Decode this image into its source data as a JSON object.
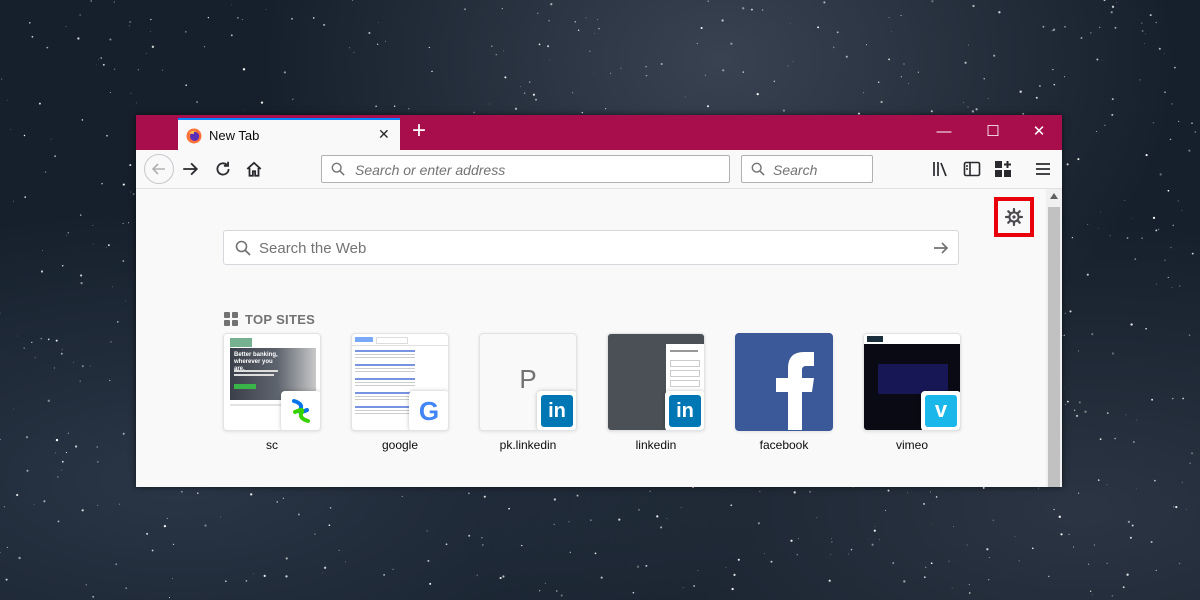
{
  "browser": {
    "tab": {
      "title": "New Tab",
      "close_glyph": "✕",
      "icon": "firefox-icon"
    },
    "new_tab_glyph": "+",
    "window_controls": {
      "minimize": "—",
      "maximize": "☐",
      "close": "✕"
    }
  },
  "navbar": {
    "url_placeholder": "Search or enter address",
    "search_placeholder": "Search"
  },
  "page": {
    "search_placeholder": "Search the Web",
    "top_sites_heading": "TOP SITES",
    "top_sites": [
      {
        "label": "sc",
        "favicon": "standard-chartered-icon",
        "preview": "sc-screenshot"
      },
      {
        "label": "google",
        "favicon": "google-icon",
        "preview": "google-screenshot"
      },
      {
        "label": "pk.linkedin",
        "favicon": "linkedin-icon",
        "preview": "letter",
        "letter": "P"
      },
      {
        "label": "linkedin",
        "favicon": "linkedin-icon",
        "preview": "linkedin-screenshot"
      },
      {
        "label": "facebook",
        "favicon": "facebook-icon",
        "preview": "facebook-logo"
      },
      {
        "label": "vimeo",
        "favicon": "vimeo-icon",
        "preview": "vimeo-screenshot"
      }
    ],
    "sc_preview_text": {
      "headline": "Better banking, wherever you are."
    }
  },
  "colors": {
    "titlebar": "#a90e4c",
    "highlight": "#e8000b",
    "tab_accent": "#0a84ff",
    "linkedin": "#0077b5",
    "facebook": "#3b5998",
    "vimeo": "#1ab7ea"
  }
}
